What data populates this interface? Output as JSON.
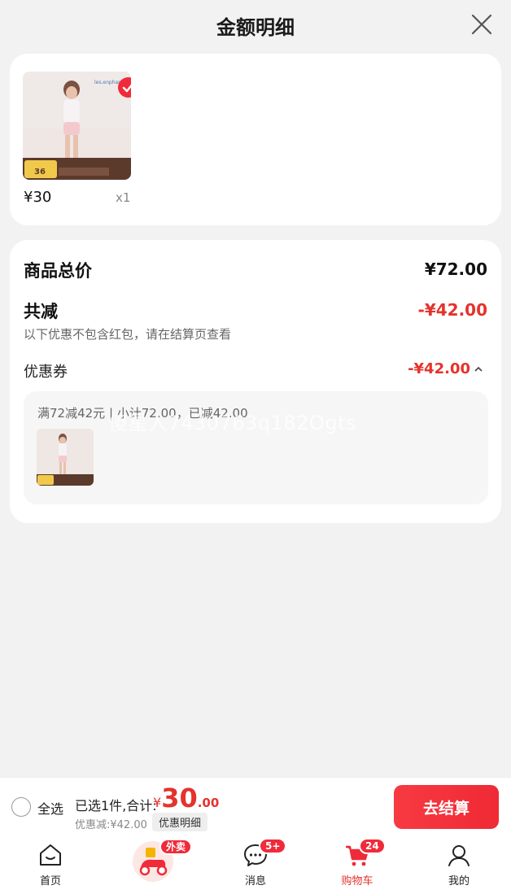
{
  "header": {
    "title": "金额明细"
  },
  "product": {
    "price": "¥30",
    "qty": "x1"
  },
  "summary": {
    "total_label": "商品总价",
    "total_value": "¥72.00",
    "reduce_label": "共减",
    "reduce_value": "-¥42.00",
    "note": "以下优惠不包含红包，请在结算页查看",
    "coupon_label": "优惠券",
    "coupon_value": "-¥42.00",
    "coupon_desc": "满72减42元 | 小计72.00，已减42.00"
  },
  "watermark": "傻星人7430763q182Ogts",
  "checkout": {
    "select_all": "全选",
    "selected_text": "已选1件,合计:",
    "currency": "¥",
    "total_int": "30",
    "total_dec": ".00",
    "discount_text": "优惠减:¥42.00",
    "detail_btn": "优惠明细",
    "checkout_btn": "去结算"
  },
  "tabs": [
    {
      "label": "首页",
      "icon": "home-icon"
    },
    {
      "label": "",
      "icon": "takeout-scooter-icon",
      "badge": "外卖"
    },
    {
      "label": "消息",
      "icon": "message-icon",
      "badge": "5+"
    },
    {
      "label": "购物车",
      "icon": "cart-icon",
      "badge": "24"
    },
    {
      "label": "我的",
      "icon": "profile-icon"
    }
  ],
  "colors": {
    "accent": "#e4332d",
    "button": "#ef2a35",
    "background": "#f2f2f2"
  }
}
